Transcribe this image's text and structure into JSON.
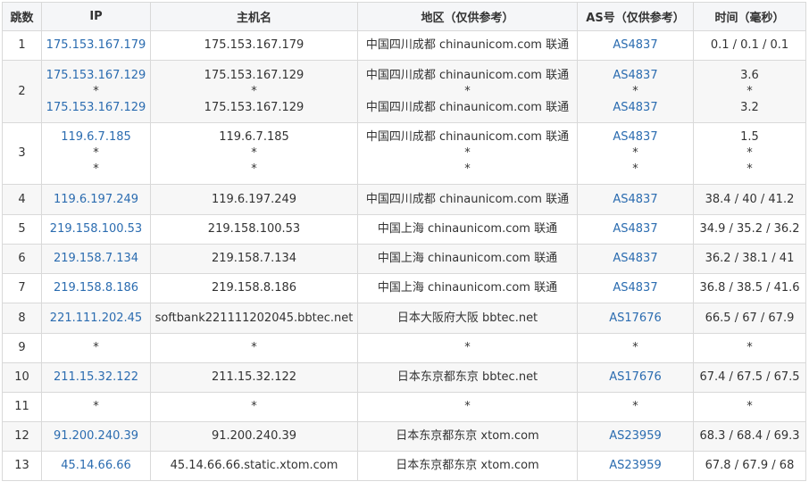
{
  "headers": {
    "hop": "跳数",
    "ip": "IP",
    "hostname": "主机名",
    "region": "地区（仅供参考）",
    "asn": "AS号（仅供参考）",
    "time": "时间（毫秒）"
  },
  "rows": [
    {
      "hop": "1",
      "ip": [
        "175.153.167.179"
      ],
      "host": [
        "175.153.167.179"
      ],
      "region": [
        "中国四川成都 chinaunicom.com 联通"
      ],
      "asn": [
        "AS4837"
      ],
      "time": [
        "0.1 / 0.1 / 0.1"
      ]
    },
    {
      "hop": "2",
      "ip": [
        "175.153.167.129",
        "*",
        "175.153.167.129"
      ],
      "host": [
        "175.153.167.129",
        "*",
        "175.153.167.129"
      ],
      "region": [
        "中国四川成都 chinaunicom.com 联通",
        "*",
        "中国四川成都 chinaunicom.com 联通"
      ],
      "asn": [
        "AS4837",
        "*",
        "AS4837"
      ],
      "time": [
        "3.6",
        "*",
        "3.2"
      ]
    },
    {
      "hop": "3",
      "ip": [
        "119.6.7.185",
        "*",
        "*"
      ],
      "host": [
        "119.6.7.185",
        "*",
        "*"
      ],
      "region": [
        "中国四川成都 chinaunicom.com 联通",
        "*",
        "*"
      ],
      "asn": [
        "AS4837",
        "*",
        "*"
      ],
      "time": [
        "1.5",
        "*",
        "*"
      ]
    },
    {
      "hop": "4",
      "ip": [
        "119.6.197.249"
      ],
      "host": [
        "119.6.197.249"
      ],
      "region": [
        "中国四川成都 chinaunicom.com 联通"
      ],
      "asn": [
        "AS4837"
      ],
      "time": [
        "38.4 / 40 / 41.2"
      ]
    },
    {
      "hop": "5",
      "ip": [
        "219.158.100.53"
      ],
      "host": [
        "219.158.100.53"
      ],
      "region": [
        "中国上海 chinaunicom.com 联通"
      ],
      "asn": [
        "AS4837"
      ],
      "time": [
        "34.9 / 35.2 / 36.2"
      ]
    },
    {
      "hop": "6",
      "ip": [
        "219.158.7.134"
      ],
      "host": [
        "219.158.7.134"
      ],
      "region": [
        "中国上海 chinaunicom.com 联通"
      ],
      "asn": [
        "AS4837"
      ],
      "time": [
        "36.2 / 38.1 / 41"
      ]
    },
    {
      "hop": "7",
      "ip": [
        "219.158.8.186"
      ],
      "host": [
        "219.158.8.186"
      ],
      "region": [
        "中国上海 chinaunicom.com 联通"
      ],
      "asn": [
        "AS4837"
      ],
      "time": [
        "36.8 / 38.5 / 41.6"
      ]
    },
    {
      "hop": "8",
      "ip": [
        "221.111.202.45"
      ],
      "host": [
        "softbank221111202045.bbtec.net"
      ],
      "region": [
        "日本大阪府大阪 bbtec.net"
      ],
      "asn": [
        "AS17676"
      ],
      "time": [
        "66.5 / 67 / 67.9"
      ]
    },
    {
      "hop": "9",
      "ip": [
        "*"
      ],
      "host": [
        "*"
      ],
      "region": [
        "*"
      ],
      "asn": [
        "*"
      ],
      "time": [
        "*"
      ]
    },
    {
      "hop": "10",
      "ip": [
        "211.15.32.122"
      ],
      "host": [
        "211.15.32.122"
      ],
      "region": [
        "日本东京都东京 bbtec.net"
      ],
      "asn": [
        "AS17676"
      ],
      "time": [
        "67.4 / 67.5 / 67.5"
      ]
    },
    {
      "hop": "11",
      "ip": [
        "*"
      ],
      "host": [
        "*"
      ],
      "region": [
        "*"
      ],
      "asn": [
        "*"
      ],
      "time": [
        "*"
      ]
    },
    {
      "hop": "12",
      "ip": [
        "91.200.240.39"
      ],
      "host": [
        "91.200.240.39"
      ],
      "region": [
        "日本东京都东京 xtom.com"
      ],
      "asn": [
        "AS23959"
      ],
      "time": [
        "68.3 / 68.4 / 69.3"
      ]
    },
    {
      "hop": "13",
      "ip": [
        "45.14.66.66"
      ],
      "host": [
        "45.14.66.66.static.xtom.com"
      ],
      "region": [
        "日本东京都东京 xtom.com"
      ],
      "asn": [
        "AS23959"
      ],
      "time": [
        "67.8 / 67.9 / 68"
      ]
    }
  ],
  "colors": {
    "link": "#2b6cb0",
    "text": "#333333",
    "border": "#d9d9d9",
    "header_bg": "#f5f6f8",
    "stripe_bg": "#f7f7f7"
  }
}
